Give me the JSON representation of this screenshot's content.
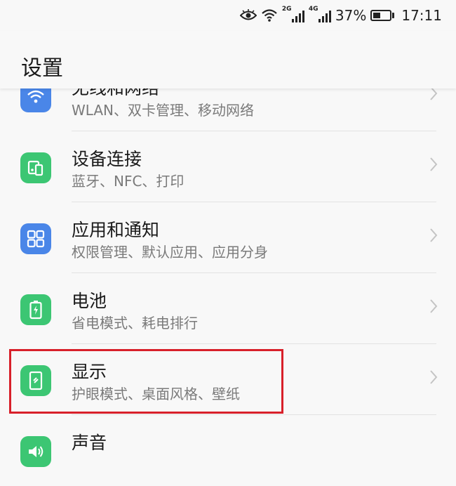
{
  "status": {
    "sig1_net": "2G",
    "sig2_net": "4G",
    "battery": "37%",
    "time": "17:11"
  },
  "header": {
    "title": "设置"
  },
  "items": [
    {
      "title": "无线和网络",
      "subtitle": "WLAN、双卡管理、移动网络",
      "icon": "wifi-icon",
      "icon_color": "#4a86e8"
    },
    {
      "title": "设备连接",
      "subtitle": "蓝牙、NFC、打印",
      "icon": "device-connect-icon",
      "icon_color": "#3cc673"
    },
    {
      "title": "应用和通知",
      "subtitle": "权限管理、默认应用、应用分身",
      "icon": "apps-grid-icon",
      "icon_color": "#4a86e8"
    },
    {
      "title": "电池",
      "subtitle": "省电模式、耗电排行",
      "icon": "battery-icon",
      "icon_color": "#3cc673"
    },
    {
      "title": "显示",
      "subtitle": "护眼模式、桌面风格、壁纸",
      "icon": "display-icon",
      "icon_color": "#3cc673"
    },
    {
      "title": "声音",
      "subtitle": "",
      "icon": "sound-icon",
      "icon_color": "#3cc673"
    }
  ],
  "colors": {
    "highlight_border": "#d8202a",
    "accent_blue": "#4a86e8",
    "accent_green": "#3cc673"
  }
}
